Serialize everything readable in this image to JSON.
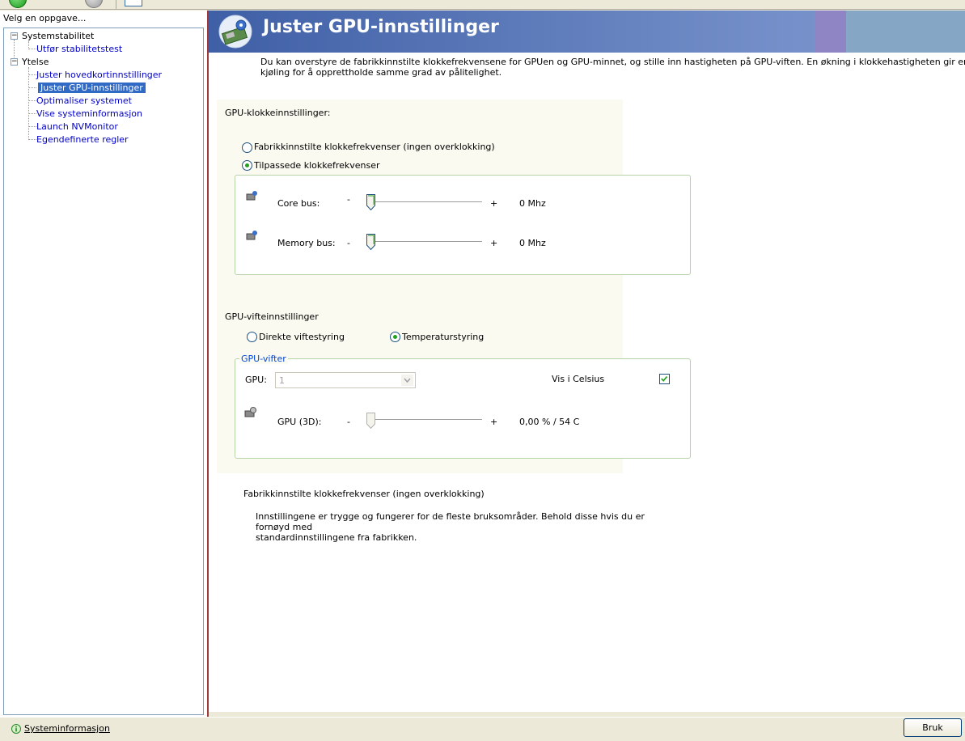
{
  "left_pane": {
    "title": "Velg en oppgave...",
    "tree": {
      "group1": {
        "label": "Systemstabilitet",
        "expander": "⊟"
      },
      "group1_item1": "Utfør stabilitetstest",
      "group2": {
        "label": "Ytelse",
        "expander": "⊟"
      },
      "group2_items": [
        "Juster hovedkortinnstillinger",
        "Juster GPU-innstillinger",
        "Optimaliser systemet",
        "Vise systeminformasjon",
        "Launch NVMonitor",
        "Egendefinerte regler"
      ],
      "selected_index": 1
    }
  },
  "header": {
    "title": "Juster GPU-innstillinger"
  },
  "intro": {
    "line1": "Du kan overstyre de fabrikkinnstilte klokkefrekvensene for GPUen og GPU-minnet, og stille inn hastigheten på GPU-viften. En økning i klokkehastigheten gir en økning i GPU-ytelsen, me",
    "line2": "kjøling for å opprettholde samme grad av pålitelighet."
  },
  "clock": {
    "section_label": "GPU-klokkeinnstillinger:",
    "radio_factory": "Fabrikkinnstilte klokkefrekvenser (ingen overklokking)",
    "radio_custom": "Tilpassede klokkefrekvenser",
    "selected": "custom",
    "core": {
      "label": "Core bus:",
      "minus": "-",
      "plus": "+",
      "value": "0 Mhz",
      "level": 0.0
    },
    "memory": {
      "label": "Memory bus:",
      "minus": "-",
      "plus": "+",
      "value": "0 Mhz",
      "level": 0.0
    }
  },
  "fan": {
    "section_label": "GPU-vifteinnstillinger",
    "radio_direct": "Direkte viftestyring",
    "radio_temp": "Temperaturstyring",
    "selected": "temp",
    "group_legend": "GPU-vifter",
    "gpu_label": "GPU:",
    "gpu_value": "1",
    "celsius_label": "Vis i Celsius",
    "celsius_checked": true,
    "gpu3d": {
      "label": "GPU (3D):",
      "minus": "-",
      "plus": "+",
      "value": "0,00 % / 54 C",
      "level": 0.0
    }
  },
  "description": {
    "title": "Fabrikkinnstilte klokkefrekvenser (ingen overklokking)",
    "line1": "Innstillingene er trygge og fungerer for de fleste bruksområder. Behold disse hvis du er fornøyd med",
    "line2": "standardinnstillingene fra fabrikken."
  },
  "bottom": {
    "sysinfo_link": "Systeminformasjon",
    "apply_label": "Bruk"
  },
  "colors": {
    "header_blue": "#3f5fa6",
    "selection_blue": "#316ac5",
    "radio_green": "#21a121",
    "link_blue": "#0000cc"
  }
}
